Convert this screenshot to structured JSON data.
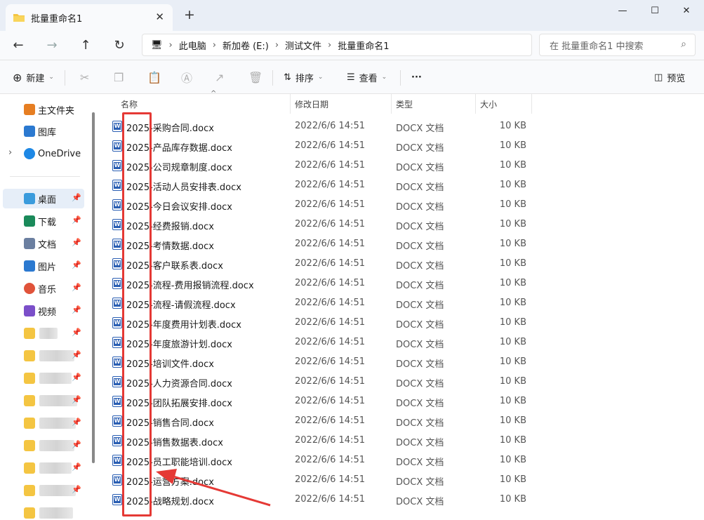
{
  "window": {
    "tab_title": "批量重命名1",
    "new_tab": "+"
  },
  "nav": {
    "breadcrumbs": [
      "此电脑",
      "新加卷 (E:)",
      "测试文件",
      "批量重命名1"
    ],
    "search_placeholder": "在 批量重命名1 中搜索"
  },
  "toolbar": {
    "new_label": "新建",
    "sort_label": "排序",
    "view_label": "查看",
    "more_label": "···",
    "preview_label": "预览"
  },
  "sidebar": {
    "top_items": [
      {
        "label": "主文件夹",
        "icon": "home-icon",
        "color": "#e67e22"
      },
      {
        "label": "图库",
        "icon": "gallery-icon",
        "color": "#2b79d0"
      },
      {
        "label": "OneDrive",
        "icon": "cloud-icon",
        "color": "#1e88e5"
      }
    ],
    "pinned": [
      {
        "label": "桌面",
        "icon": "desktop-icon",
        "color": "#3a9bdc"
      },
      {
        "label": "下载",
        "icon": "download-icon",
        "color": "#1a8a5a"
      },
      {
        "label": "文档",
        "icon": "document-icon",
        "color": "#6b7fa0"
      },
      {
        "label": "图片",
        "icon": "picture-icon",
        "color": "#2b79d0"
      },
      {
        "label": "音乐",
        "icon": "music-icon",
        "color": "#e0533a"
      },
      {
        "label": "视频",
        "icon": "video-icon",
        "color": "#7b4fc9"
      }
    ]
  },
  "columns": {
    "name": "名称",
    "date": "修改日期",
    "type": "类型",
    "size": "大小"
  },
  "files": [
    {
      "name": "2025-采购合同.docx",
      "date": "2022/6/6 14:51",
      "type": "DOCX 文档",
      "size": "10 KB"
    },
    {
      "name": "2025-产品库存数据.docx",
      "date": "2022/6/6 14:51",
      "type": "DOCX 文档",
      "size": "10 KB"
    },
    {
      "name": "2025-公司规章制度.docx",
      "date": "2022/6/6 14:51",
      "type": "DOCX 文档",
      "size": "10 KB"
    },
    {
      "name": "2025-活动人员安排表.docx",
      "date": "2022/6/6 14:51",
      "type": "DOCX 文档",
      "size": "10 KB"
    },
    {
      "name": "2025-今日会议安排.docx",
      "date": "2022/6/6 14:51",
      "type": "DOCX 文档",
      "size": "10 KB"
    },
    {
      "name": "2025-经费报销.docx",
      "date": "2022/6/6 14:51",
      "type": "DOCX 文档",
      "size": "10 KB"
    },
    {
      "name": "2025-考情数据.docx",
      "date": "2022/6/6 14:51",
      "type": "DOCX 文档",
      "size": "10 KB"
    },
    {
      "name": "2025-客户联系表.docx",
      "date": "2022/6/6 14:51",
      "type": "DOCX 文档",
      "size": "10 KB"
    },
    {
      "name": "2025-流程-费用报销流程.docx",
      "date": "2022/6/6 14:51",
      "type": "DOCX 文档",
      "size": "10 KB"
    },
    {
      "name": "2025-流程-请假流程.docx",
      "date": "2022/6/6 14:51",
      "type": "DOCX 文档",
      "size": "10 KB"
    },
    {
      "name": "2025-年度费用计划表.docx",
      "date": "2022/6/6 14:51",
      "type": "DOCX 文档",
      "size": "10 KB"
    },
    {
      "name": "2025-年度旅游计划.docx",
      "date": "2022/6/6 14:51",
      "type": "DOCX 文档",
      "size": "10 KB"
    },
    {
      "name": "2025-培训文件.docx",
      "date": "2022/6/6 14:51",
      "type": "DOCX 文档",
      "size": "10 KB"
    },
    {
      "name": "2025-人力资源合同.docx",
      "date": "2022/6/6 14:51",
      "type": "DOCX 文档",
      "size": "10 KB"
    },
    {
      "name": "2025-团队拓展安排.docx",
      "date": "2022/6/6 14:51",
      "type": "DOCX 文档",
      "size": "10 KB"
    },
    {
      "name": "2025-销售合同.docx",
      "date": "2022/6/6 14:51",
      "type": "DOCX 文档",
      "size": "10 KB"
    },
    {
      "name": "2025-销售数据表.docx",
      "date": "2022/6/6 14:51",
      "type": "DOCX 文档",
      "size": "10 KB"
    },
    {
      "name": "2025-员工职能培训.docx",
      "date": "2022/6/6 14:51",
      "type": "DOCX 文档",
      "size": "10 KB"
    },
    {
      "name": "2025-运营方案.docx",
      "date": "2022/6/6 14:51",
      "type": "DOCX 文档",
      "size": "10 KB"
    },
    {
      "name": "2025-战略规划.docx",
      "date": "2022/6/6 14:51",
      "type": "DOCX 文档",
      "size": "10 KB"
    }
  ],
  "annotation_color": "#e53935"
}
